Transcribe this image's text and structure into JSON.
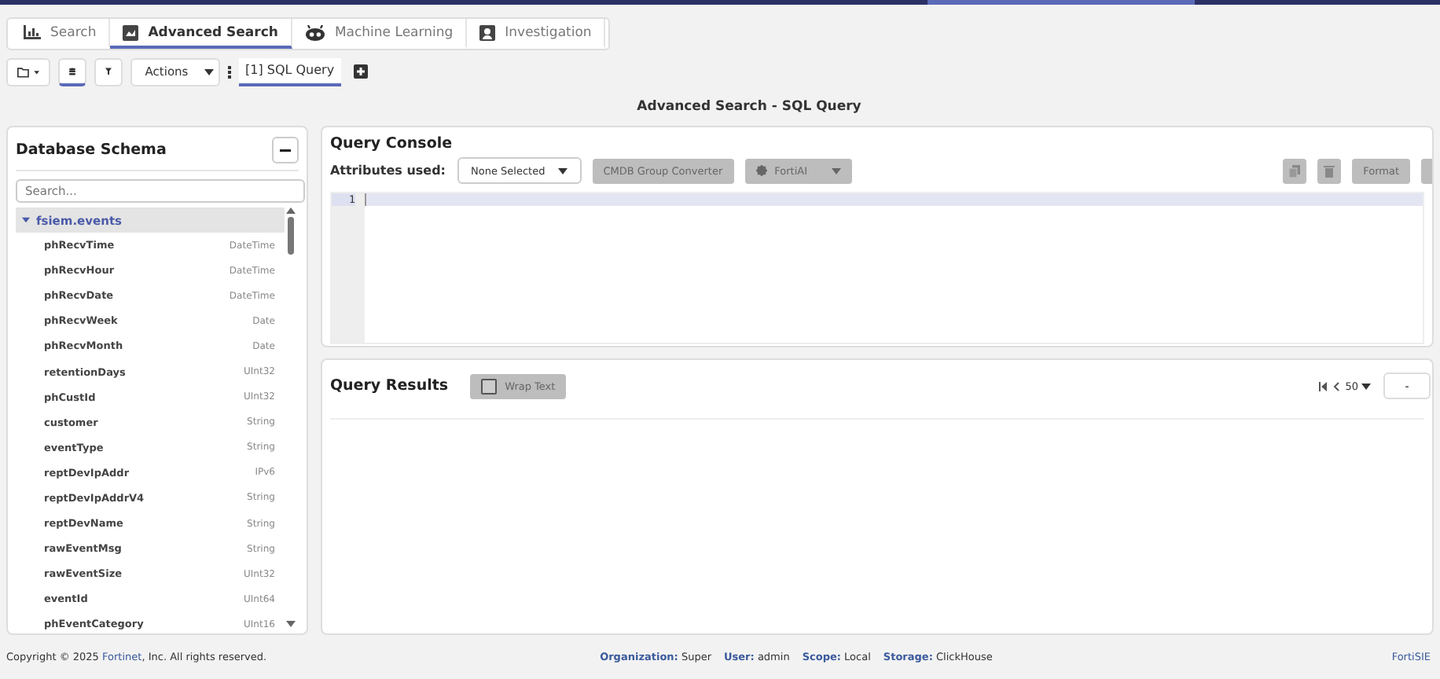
{
  "tabs": [
    {
      "label": "Search",
      "selected": false
    },
    {
      "label": "Advanced Search",
      "selected": true
    },
    {
      "label": "Machine Learning",
      "selected": false
    },
    {
      "label": "Investigation",
      "selected": false
    }
  ],
  "toolbar": {
    "buttons": [
      {
        "kind": "folder",
        "selected": false
      },
      {
        "kind": "database",
        "selected": true
      },
      {
        "kind": "filter",
        "selected": false
      }
    ],
    "actions": "Actions",
    "query_tabs": [
      {
        "label": "[1] SQL Query",
        "selected": true
      }
    ]
  },
  "page_title": "Advanced Search - SQL Query",
  "schema": {
    "title": "Database Schema",
    "placeholder": "Search...",
    "table": {
      "name": "fsiem.events",
      "expanded": true,
      "columns": [
        {
          "name": "phRecvTime",
          "type": "DateTime"
        },
        {
          "name": "phRecvHour",
          "type": "DateTime"
        },
        {
          "name": "phRecvDate",
          "type": "DateTime"
        },
        {
          "name": "phRecvWeek",
          "type": "Date"
        },
        {
          "name": "phRecvMonth",
          "type": "Date"
        },
        {
          "name": "retentionDays",
          "type": "UInt32"
        },
        {
          "name": "phCustId",
          "type": "UInt32"
        },
        {
          "name": "customer",
          "type": "String"
        },
        {
          "name": "eventType",
          "type": "String"
        },
        {
          "name": "reptDevIpAddr",
          "type": "IPv6"
        },
        {
          "name": "reptDevIpAddrV4",
          "type": "String"
        },
        {
          "name": "reptDevName",
          "type": "String"
        },
        {
          "name": "rawEventMsg",
          "type": "String"
        },
        {
          "name": "rawEventSize",
          "type": "UInt32"
        },
        {
          "name": "eventId",
          "type": "UInt64"
        },
        {
          "name": "phEventCategory",
          "type": "UInt16"
        }
      ]
    }
  },
  "console": {
    "title": "Query Console",
    "attributes_label": "Attributes used:",
    "attributes_value": "None Selected",
    "converter": "CMDB Group Converter",
    "ai": "FortiAI",
    "format": "Format",
    "line_numbers": [
      "1"
    ]
  },
  "results": {
    "title": "Query Results",
    "wrap_text": {
      "label": "Wrap Text",
      "checked": false
    },
    "page_size": "50",
    "page_field": "-"
  },
  "footer": {
    "copyright_before": "Copyright © 2025 ",
    "copyright_link": "Fortinet",
    "copyright_after": ", Inc. All rights reserved.",
    "status": [
      {
        "label": "Organization:",
        "value": "Super"
      },
      {
        "label": "User:",
        "value": "admin"
      },
      {
        "label": "Scope:",
        "value": "Local"
      },
      {
        "label": "Storage:",
        "value": "ClickHouse"
      }
    ],
    "product": "FortiSIE"
  }
}
